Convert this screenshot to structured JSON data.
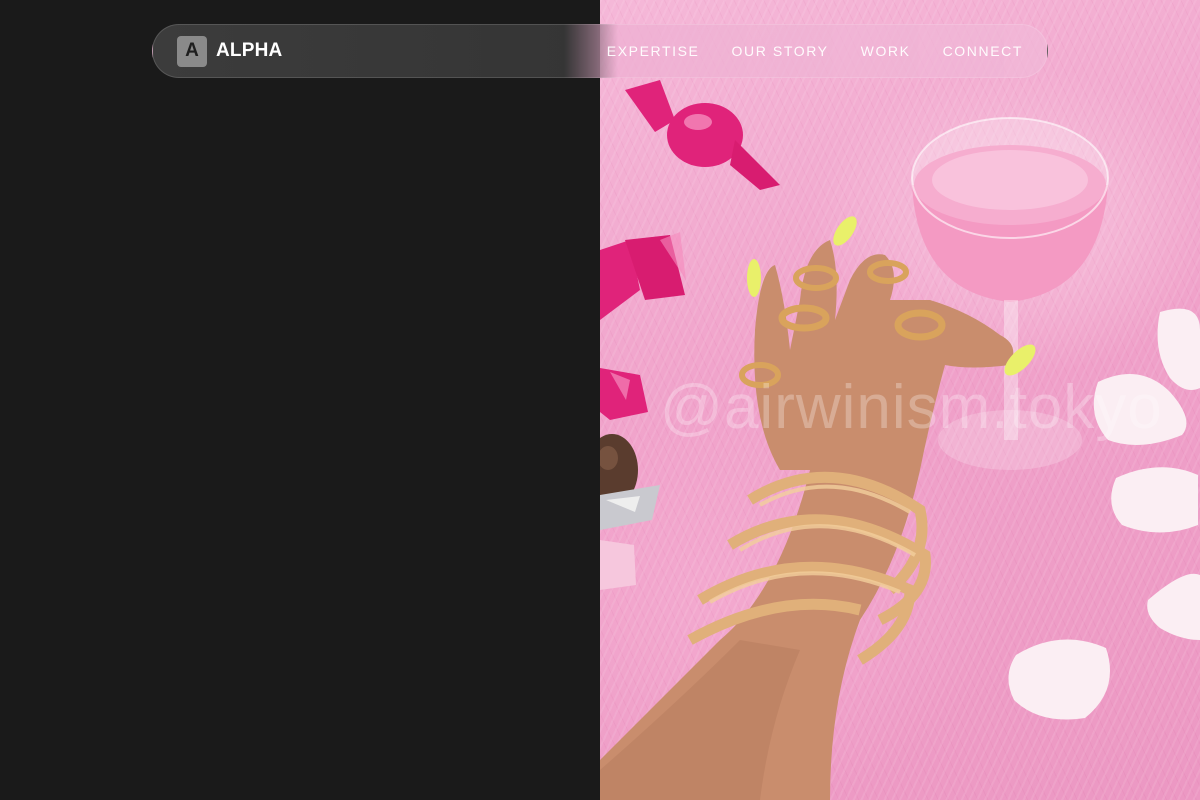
{
  "brand": {
    "logo_letter": "A",
    "name": "ALPHA"
  },
  "nav": {
    "items": [
      {
        "label": "EXPERTISE"
      },
      {
        "label": "OUR STORY"
      },
      {
        "label": "WORK"
      },
      {
        "label": "CONNECT"
      }
    ]
  },
  "hero_image": {
    "watermark": "@airwinism.tokyo"
  },
  "colors": {
    "dark_panel": "#1a1a1a",
    "photo_pink": "#f0a2ca",
    "accent_magenta": "#e0237a",
    "gold": "#d9a35c",
    "nail_yellow": "#e9f06a"
  }
}
